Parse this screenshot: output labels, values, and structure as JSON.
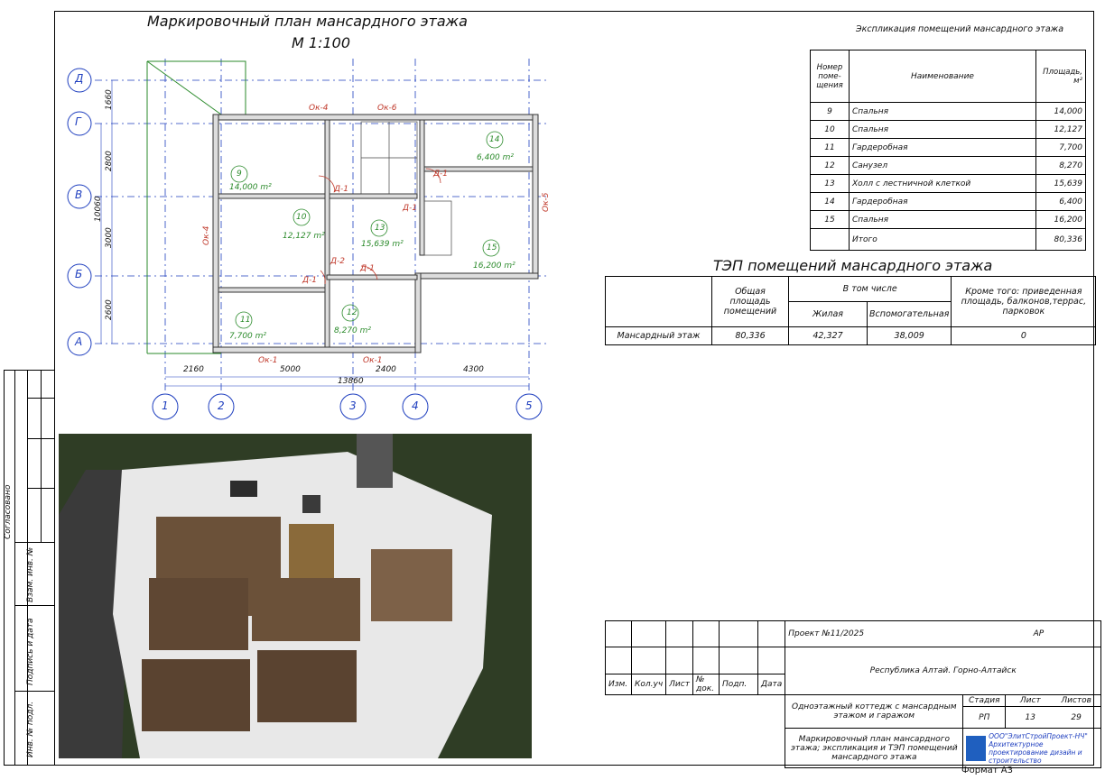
{
  "plan": {
    "title": "Маркировочный план мансардного этажа",
    "scale": "М 1:100",
    "axes_letters": [
      "Д",
      "Г",
      "В",
      "Б",
      "А"
    ],
    "axes_numbers": [
      "1",
      "2",
      "3",
      "4",
      "5"
    ],
    "dims_vertical": [
      "1660",
      "2800",
      "3000",
      "2600",
      "10060"
    ],
    "dims_horizontal": [
      "2160",
      "5000",
      "2400",
      "4300"
    ],
    "dim_total": "13860",
    "windows": [
      "Ок-4",
      "Ок-6",
      "Ок-4",
      "Ок-5",
      "Ок-1",
      "Ок-1"
    ],
    "doors": [
      "Д-1",
      "Д-1",
      "Д-1",
      "Д-2",
      "Д-1",
      "Д-1"
    ],
    "rooms": [
      {
        "num": "9",
        "area": "14,000 m²"
      },
      {
        "num": "10",
        "area": "12,127 m²"
      },
      {
        "num": "11",
        "area": "7,700 m²"
      },
      {
        "num": "12",
        "area": "8,270 m²"
      },
      {
        "num": "13",
        "area": "15,639 m²"
      },
      {
        "num": "14",
        "area": "6,400 m²"
      },
      {
        "num": "15",
        "area": "16,200 m²"
      }
    ]
  },
  "explication": {
    "title": "Экспликация помещений мансардного этажа",
    "headers": {
      "num": "Номер поме- щения",
      "name": "Наименование",
      "area": "Площадь, м²"
    },
    "rows": [
      {
        "num": "9",
        "name": "Спальня",
        "area": "14,000"
      },
      {
        "num": "10",
        "name": "Спальня",
        "area": "12,127"
      },
      {
        "num": "11",
        "name": "Гардеробная",
        "area": "7,700"
      },
      {
        "num": "12",
        "name": "Санузел",
        "area": "8,270"
      },
      {
        "num": "13",
        "name": "Холл с лестничной клеткой",
        "area": "15,639"
      },
      {
        "num": "14",
        "name": "Гардеробная",
        "area": "6,400"
      },
      {
        "num": "15",
        "name": "Спальня",
        "area": "16,200"
      }
    ],
    "total_label": "Итого",
    "total_value": "80,336"
  },
  "tep": {
    "title": "ТЭП помещений мансардного этажа",
    "h_total": "Общая площадь помещений",
    "h_incl": "В том числе",
    "h_living": "Жилая",
    "h_aux": "Вспомогательная",
    "h_extra": "Кроме того: приведенная площадь, балконов,террас, парковок",
    "row_label": "Мансардный этаж",
    "row_total": "80,336",
    "row_living": "42,327",
    "row_aux": "38,009",
    "row_extra": "0"
  },
  "stamp": {
    "project": "Проект №11/2025",
    "code": "АР",
    "location": "Республика Алтай. Горно-Алтайск",
    "object": "Одноэтажный коттедж с мансардным этажом и гаражом",
    "sheet_title": "Маркировочный план мансардного этажа; экспликация и ТЭП помещений мансардного этажа",
    "cols": [
      "Изм.",
      "Кол.уч",
      "Лист",
      "№ док.",
      "Подп.",
      "Дата"
    ],
    "stage_label": "Стадия",
    "sheet_label": "Лист",
    "sheets_label": "Листов",
    "stage": "РП",
    "sheet": "13",
    "sheets": "29",
    "company": "ООО\"ЭлитСтройПроект-НЧ\" Архитектурное проектирование дизайн и строительство",
    "format": "Формат А3"
  },
  "side": {
    "agreed": "Согласовано",
    "inv_vz": "Взам. инв. №",
    "signature": "Подпись и дата",
    "inv_orig": "Инв. № подл."
  },
  "colors": {
    "axis": "#1f3fbf",
    "room_green": "#2a8a2a",
    "door_red": "#c0392b",
    "floor": "#6b5139"
  }
}
